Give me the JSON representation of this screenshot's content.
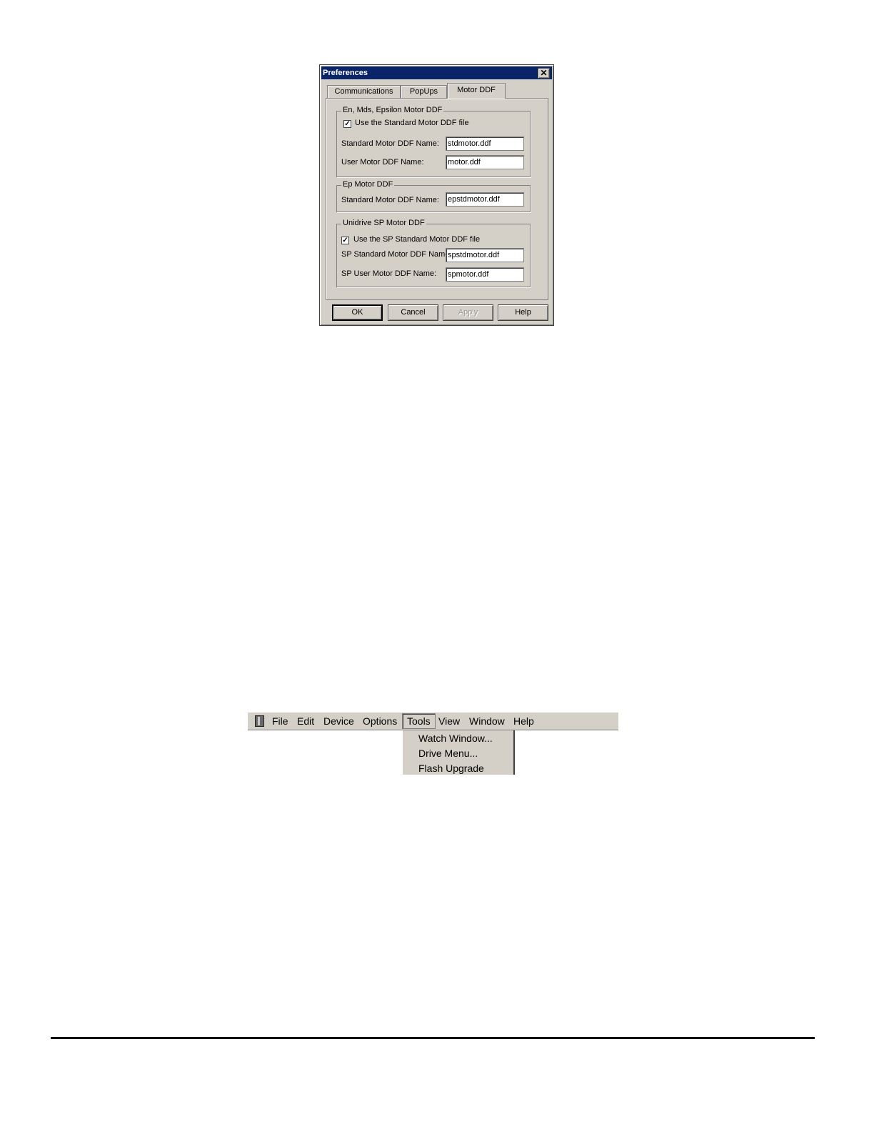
{
  "dialog": {
    "title": "Preferences",
    "close_glyph": "✕",
    "tabs": [
      {
        "label": "Communications"
      },
      {
        "label": "PopUps"
      },
      {
        "label": "Motor DDF",
        "active": true
      }
    ],
    "group1": {
      "legend": "En, Mds, Epsilon Motor DDF",
      "checkbox_label": "Use the Standard Motor DDF file",
      "checked": true,
      "std_label": "Standard Motor DDF Name:",
      "std_value": "stdmotor.ddf",
      "user_label": "User Motor DDF Name:",
      "user_value": "motor.ddf"
    },
    "group2": {
      "legend": "Ep Motor DDF",
      "std_label": "Standard Motor DDF Name:",
      "std_value": "epstdmotor.ddf"
    },
    "group3": {
      "legend": "Unidrive SP Motor DDF",
      "checkbox_label": "Use the SP Standard Motor DDF file",
      "checked": true,
      "std_label": "SP Standard Motor DDF Name:",
      "std_value": "spstdmotor.ddf",
      "user_label": "SP User Motor DDF Name:",
      "user_value": "spmotor.ddf"
    },
    "buttons": {
      "ok": "OK",
      "cancel": "Cancel",
      "apply": "Apply",
      "help": "Help"
    }
  },
  "menubar": {
    "icon": "drive-app-icon",
    "items": [
      "File",
      "Edit",
      "Device",
      "Options",
      "Tools",
      "View",
      "Window",
      "Help"
    ],
    "open_menu": "Tools",
    "dropdown": [
      "Watch Window...",
      "Drive Menu...",
      "Flash Upgrade"
    ]
  },
  "colors": {
    "dialog_face": "#d4d0c8",
    "titlebar": "#0a246a"
  }
}
